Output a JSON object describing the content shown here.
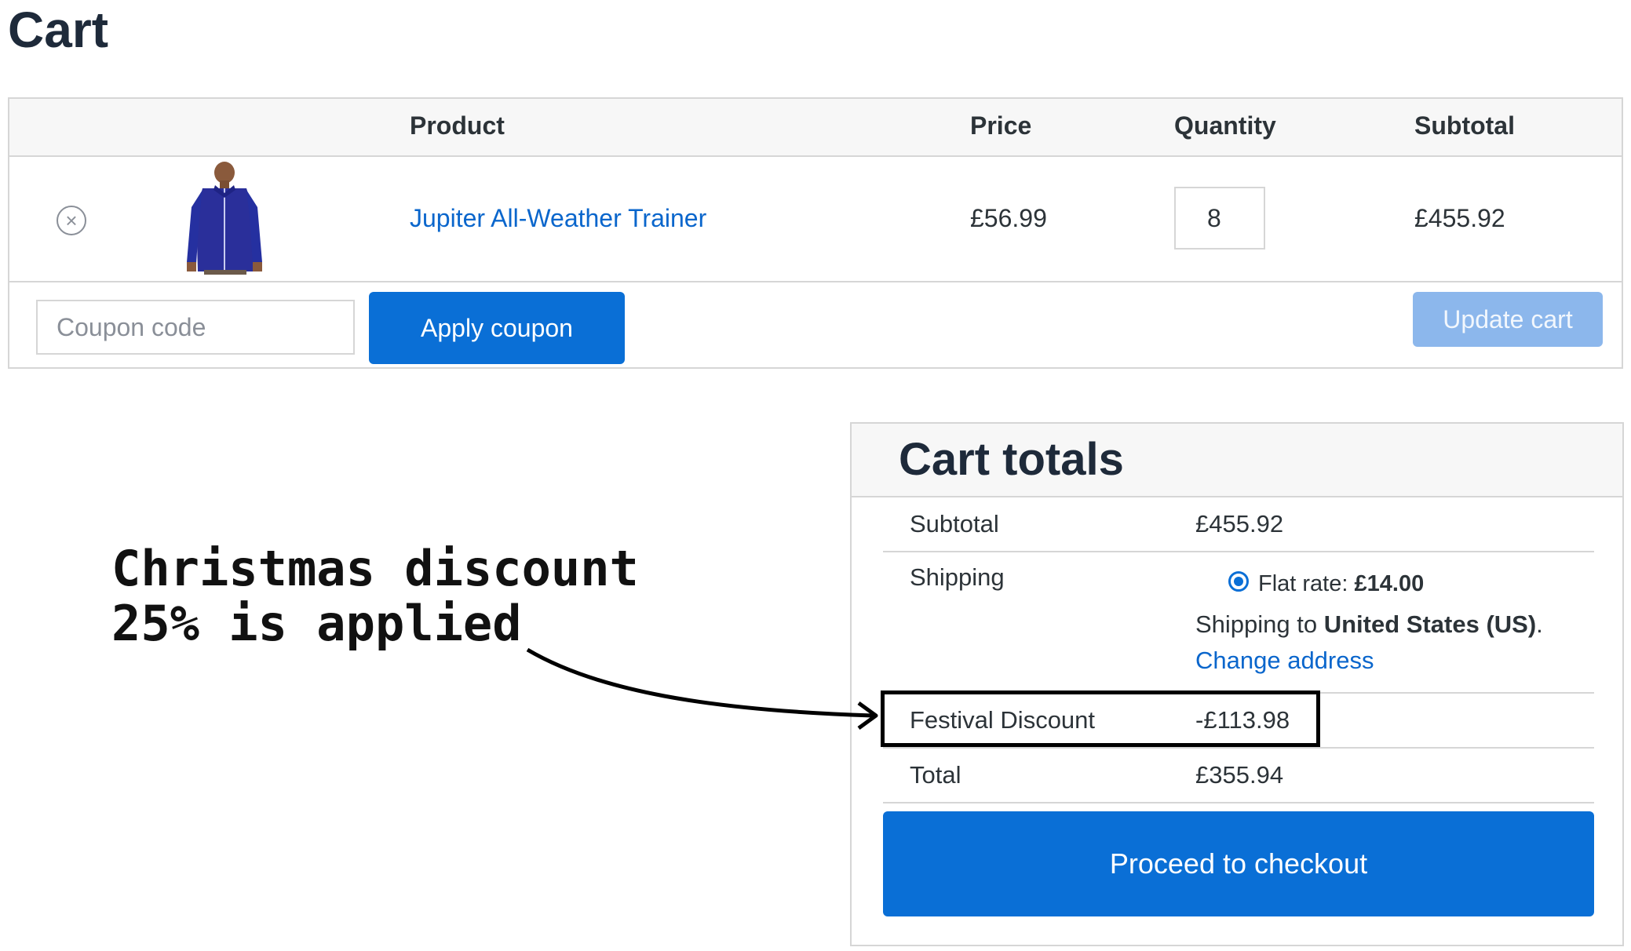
{
  "page": {
    "title": "Cart"
  },
  "table": {
    "headers": {
      "product": "Product",
      "price": "Price",
      "quantity": "Quantity",
      "subtotal": "Subtotal"
    },
    "items": [
      {
        "name": "Jupiter All-Weather Trainer",
        "price": "£56.99",
        "quantity": "8",
        "subtotal": "£455.92",
        "remove_icon": "close-circle-icon",
        "thumbnail": "blue-zip-jacket"
      }
    ]
  },
  "actions": {
    "coupon_placeholder": "Coupon code",
    "apply_label": "Apply coupon",
    "update_label": "Update cart"
  },
  "totals": {
    "title": "Cart totals",
    "subtotal_label": "Subtotal",
    "subtotal_value": "£455.92",
    "shipping_label": "Shipping",
    "shipping_method_label": "Flat rate: ",
    "shipping_method_price": "£14.00",
    "shipping_to_prefix": "Shipping to ",
    "shipping_to_country": "United States (US)",
    "shipping_to_suffix": ".",
    "change_address_label": "Change address",
    "discount_label": "Festival Discount",
    "discount_value": "-£113.98",
    "total_label": "Total",
    "total_value": "£355.94",
    "checkout_label": "Proceed to checkout"
  },
  "annotation": {
    "line1": "Christmas discount",
    "line2": "25% is applied"
  },
  "colors": {
    "primary": "#0a6fd6",
    "link": "#0a66cc",
    "disabled_button": "#8cb7ec",
    "border": "#d6d6d6"
  }
}
